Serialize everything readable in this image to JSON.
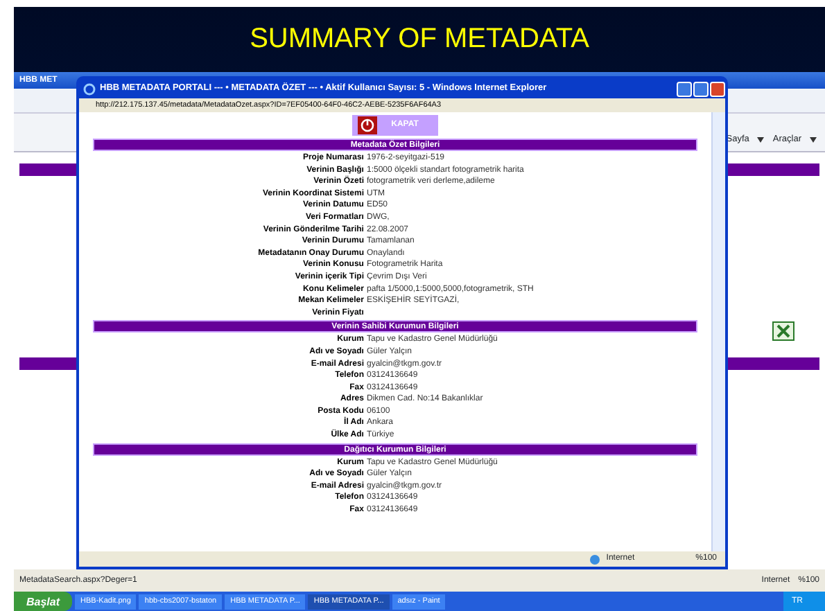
{
  "slide_title": "SUMMARY OF METADATA",
  "background_window": {
    "title": "HBB MET",
    "toolbar": [
      "Sayfa",
      "Araçlar"
    ],
    "status": {
      "url": "MetadataSearch.aspx?Deger=1",
      "zone": "Internet",
      "zoom": "%100"
    }
  },
  "popup": {
    "title": "HBB METADATA PORTALI --- • METADATA ÖZET --- • Aktif Kullanıcı Sayısı: 5 - Windows Internet Explorer",
    "url": "http://212.175.137.45/metadata/MetadataOzet.aspx?ID=7EF05400-64F0-46C2-AEBE-5235F6AF64A3",
    "close_button": "KAPAT",
    "sections": [
      {
        "title": "Metadata Özet Bilgileri",
        "fields": [
          {
            "label": "Proje Numarası",
            "value": "1976-2-seyitgazi-519"
          },
          {
            "label": "Verinin Başlığı",
            "value": "1:5000 ölçekli standart fotogrametrik harita"
          },
          {
            "label": "Verinin Özeti",
            "value": "fotogrametrik veri derleme,adileme"
          },
          {
            "label": "Verinin Koordinat Sistemi",
            "value": "UTM"
          },
          {
            "label": "Verinin Datumu",
            "value": "ED50"
          },
          {
            "label": "Veri Formatları",
            "value": "DWG,"
          },
          {
            "label": "Verinin Gönderilme Tarihi",
            "value": "22.08.2007"
          },
          {
            "label": "Verinin Durumu",
            "value": "Tamamlanan"
          },
          {
            "label": "Metadatanın Onay Durumu",
            "value": "Onaylandı"
          },
          {
            "label": "Verinin Konusu",
            "value": "Fotogrametrik Harita"
          },
          {
            "label": "Verinin içerik Tipi",
            "value": "Çevrim Dışı Veri"
          },
          {
            "label": "Konu Kelimeler",
            "value": "pafta 1/5000,1:5000,5000,fotogrametrik, STH"
          },
          {
            "label": "Mekan Kelimeler",
            "value": "ESKİŞEHİR SEYİTGAZİ,"
          },
          {
            "label": "Verinin Fiyatı"
          }
        ]
      },
      {
        "title": "Verinin Sahibi Kurumun Bilgileri",
        "fields": [
          {
            "label": "Kurum",
            "value": "Tapu ve Kadastro Genel Müdürlüğü"
          },
          {
            "label": "Adı ve Soyadı",
            "value": "Güler Yalçın"
          },
          {
            "label": "E-mail Adresi",
            "value": "gyalcin@tkgm.gov.tr"
          },
          {
            "label": "Telefon",
            "value": "03124136649"
          },
          {
            "label": "Fax",
            "value": "03124136649"
          },
          {
            "label": "Adres",
            "value": "Dikmen Cad. No:14 Bakanlıklar"
          },
          {
            "label": "Posta Kodu",
            "value": "06100"
          },
          {
            "label": "İl Adı",
            "value": "Ankara"
          },
          {
            "label": "Ülke Adı",
            "value": "Türkiye"
          }
        ]
      },
      {
        "title": "Dağıtıcı Kurumun Bilgileri",
        "fields": [
          {
            "label": "Kurum",
            "value": "Tapu ve Kadastro Genel Müdürlüğü"
          },
          {
            "label": "Adı ve Soyadı",
            "value": "Güler Yalçın"
          },
          {
            "label": "E-mail Adresi",
            "value": "gyalcin@tkgm.gov.tr"
          },
          {
            "label": "Telefon",
            "value": "03124136649"
          },
          {
            "label": "Fax",
            "value": "03124136649"
          }
        ]
      }
    ],
    "status": {
      "zone": "Internet",
      "zoom": "%100"
    }
  },
  "taskbar": {
    "start": "Başlat",
    "items": [
      {
        "label": "HBB-Kadit.png",
        "selected": false
      },
      {
        "label": "hbb-cbs2007-bstaton",
        "selected": false
      },
      {
        "label": "HBB METADATA P...",
        "selected": false
      },
      {
        "label": "HBB METADATA P...",
        "selected": true
      },
      {
        "label": "adsız - Paint",
        "selected": false
      }
    ],
    "tray": "TR"
  }
}
